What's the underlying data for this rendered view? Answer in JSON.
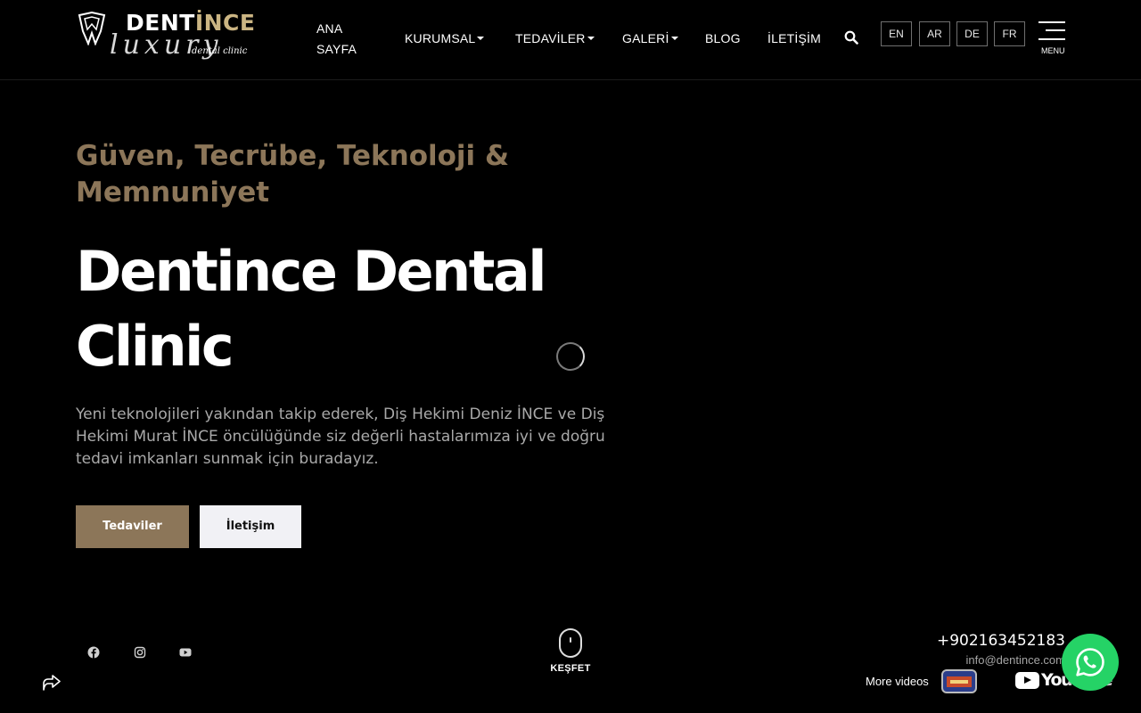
{
  "brand": {
    "name_part1": "DENT",
    "name_part2": "İNCE",
    "script": "luxury",
    "subtitle": "dental clinic",
    "accent_color": "#8c7659"
  },
  "nav": {
    "items": [
      {
        "label": "ANA SAYFA",
        "dropdown": false
      },
      {
        "label": "KURUMSAL",
        "dropdown": true
      },
      {
        "label": "TEDAVİLER",
        "dropdown": true
      },
      {
        "label": "GALERİ",
        "dropdown": true
      },
      {
        "label": "BLOG",
        "dropdown": false
      },
      {
        "label": "İLETİŞİM",
        "dropdown": false
      }
    ],
    "search_icon": "search-icon",
    "languages": [
      "EN",
      "AR",
      "DE",
      "FR"
    ],
    "menu_label": "MENU"
  },
  "hero": {
    "tagline": "Güven, Tecrübe, Teknoloji & Memnuniyet",
    "title": "Dentince Dental Clinic",
    "description": "Yeni teknolojileri yakından takip ederek, Diş Hekimi Deniz İNCE ve Diş Hekimi Murat İNCE öncülüğünde siz değerli hastalarımıza iyi ve doğru tedavi imkanları sunmak için buradayız.",
    "primary_button": "Tedaviler",
    "secondary_button": "İletişim"
  },
  "social": {
    "icons": [
      "facebook-icon",
      "instagram-icon",
      "youtube-icon"
    ]
  },
  "scroll": {
    "label": "KEŞFET"
  },
  "contact": {
    "phone": "+902163452183",
    "email": "info@dentince.com"
  },
  "video_widget": {
    "more_videos_label": "More videos",
    "youtube_wordmark": "YouTube"
  }
}
